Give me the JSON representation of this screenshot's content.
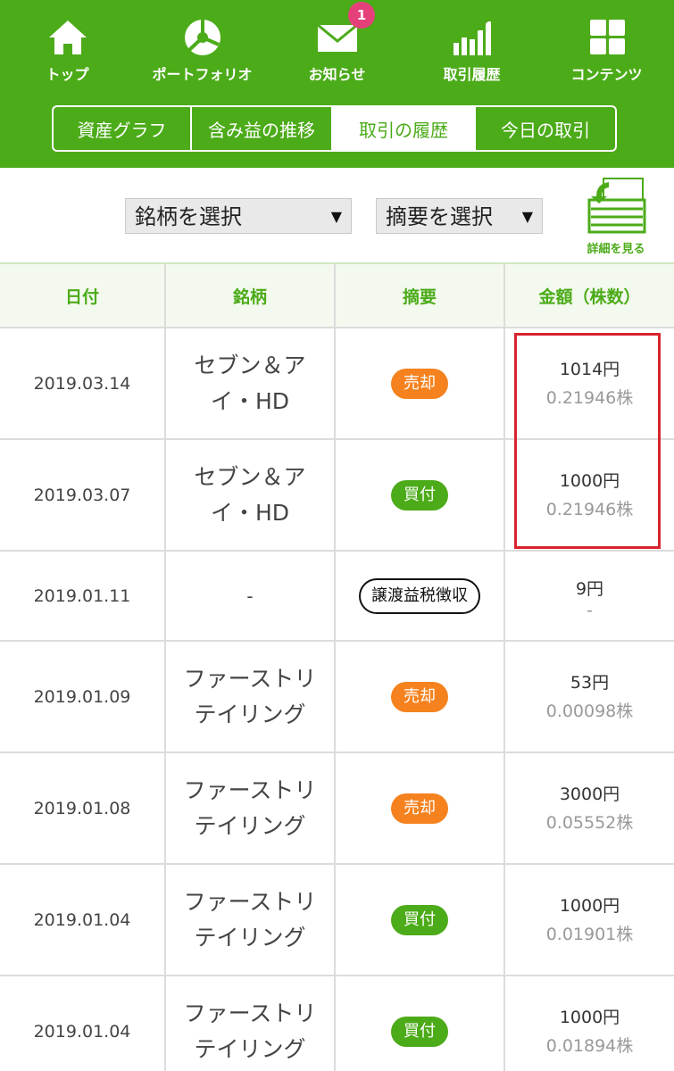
{
  "nav": {
    "items": [
      {
        "label": "トップ",
        "icon": "home-icon"
      },
      {
        "label": "ポートフォリオ",
        "icon": "portfolio-pie-icon"
      },
      {
        "label": "お知らせ",
        "icon": "mail-icon",
        "badge": "1"
      },
      {
        "label": "取引履歴",
        "icon": "bar-chart-icon"
      },
      {
        "label": "コンテンツ",
        "icon": "grid-icon"
      }
    ]
  },
  "tabs": [
    {
      "label": "資産グラフ",
      "active": false
    },
    {
      "label": "含み益の推移",
      "active": false
    },
    {
      "label": "取引の履歴",
      "active": true
    },
    {
      "label": "今日の取引",
      "active": false
    }
  ],
  "filters": {
    "stock_select": "銘柄を選択",
    "summary_select": "摘要を選択",
    "detail_label": "詳細を見る"
  },
  "table": {
    "headers": [
      "日付",
      "銘柄",
      "摘要",
      "金額（株数）"
    ],
    "rows": [
      {
        "date": "2019.03.14",
        "stock_line1": "セブン＆ア",
        "stock_line2": "イ・HD",
        "type": "売却",
        "kind": "sell",
        "amount": "1014円",
        "shares": "0.21946株"
      },
      {
        "date": "2019.03.07",
        "stock_line1": "セブン＆ア",
        "stock_line2": "イ・HD",
        "type": "買付",
        "kind": "buy",
        "amount": "1000円",
        "shares": "0.21946株"
      },
      {
        "date": "2019.01.11",
        "stock_line1": "-",
        "stock_line2": "",
        "type": "譲渡益税徴収",
        "kind": "tax",
        "amount": "9円",
        "shares": "-"
      },
      {
        "date": "2019.01.09",
        "stock_line1": "ファーストリ",
        "stock_line2": "テイリング",
        "type": "売却",
        "kind": "sell",
        "amount": "53円",
        "shares": "0.00098株"
      },
      {
        "date": "2019.01.08",
        "stock_line1": "ファーストリ",
        "stock_line2": "テイリング",
        "type": "売却",
        "kind": "sell",
        "amount": "3000円",
        "shares": "0.05552株"
      },
      {
        "date": "2019.01.04",
        "stock_line1": "ファーストリ",
        "stock_line2": "テイリング",
        "type": "買付",
        "kind": "buy",
        "amount": "1000円",
        "shares": "0.01901株"
      },
      {
        "date": "2019.01.04",
        "stock_line1": "ファーストリ",
        "stock_line2": "テイリング",
        "type": "買付",
        "kind": "buy",
        "amount": "1000円",
        "shares": "0.01894株"
      }
    ]
  },
  "colors": {
    "brand_green": "#4cab19",
    "sell_orange": "#f5821f",
    "badge_pink": "#e6407b",
    "highlight_red": "#d9232e"
  }
}
